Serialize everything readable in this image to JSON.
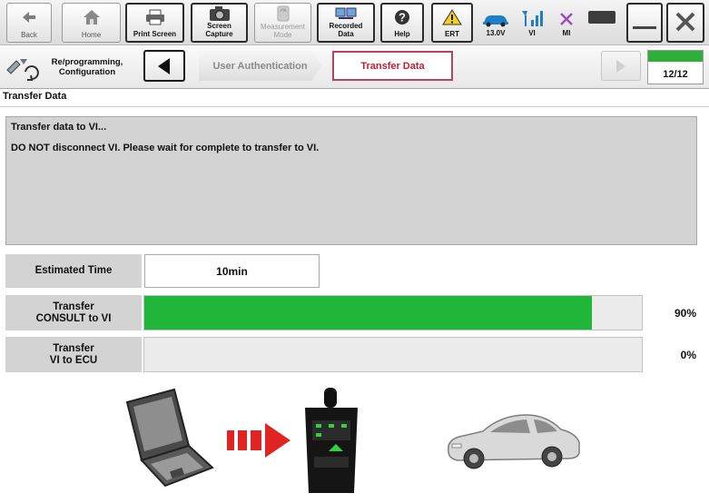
{
  "toolbar": {
    "back": "Back",
    "home": "Home",
    "print_screen": "Print Screen",
    "screen_capture": "Screen\nCapture",
    "measurement_mode": "Measurement\nMode",
    "recorded_data": "Recorded\nData",
    "help": "Help",
    "ert": "ERT",
    "battery_voltage": "13.0V",
    "vi_status": "VI",
    "mi_status": "MI"
  },
  "nav": {
    "mode_label": "Re/programming,\nConfiguration",
    "steps": [
      "User Authentication",
      "Transfer Data"
    ],
    "step_counter": "12/12",
    "step_progress": 1.0
  },
  "section_title": "Transfer Data",
  "message": {
    "line1": "Transfer data to VI...",
    "line2": "DO NOT disconnect VI. Please wait for complete to transfer to VI."
  },
  "estimated": {
    "label": "Estimated Time",
    "value": "10min"
  },
  "transfers": [
    {
      "label": "Transfer\nCONSULT to VI",
      "percent_text": "90%",
      "progress": 0.9
    },
    {
      "label": "Transfer\nVI to ECU",
      "percent_text": "0%",
      "progress": 0.0
    }
  ],
  "colors": {
    "progress": "#1fb63a",
    "active_step": "#c21f36",
    "panel": "#d3d3d3"
  }
}
